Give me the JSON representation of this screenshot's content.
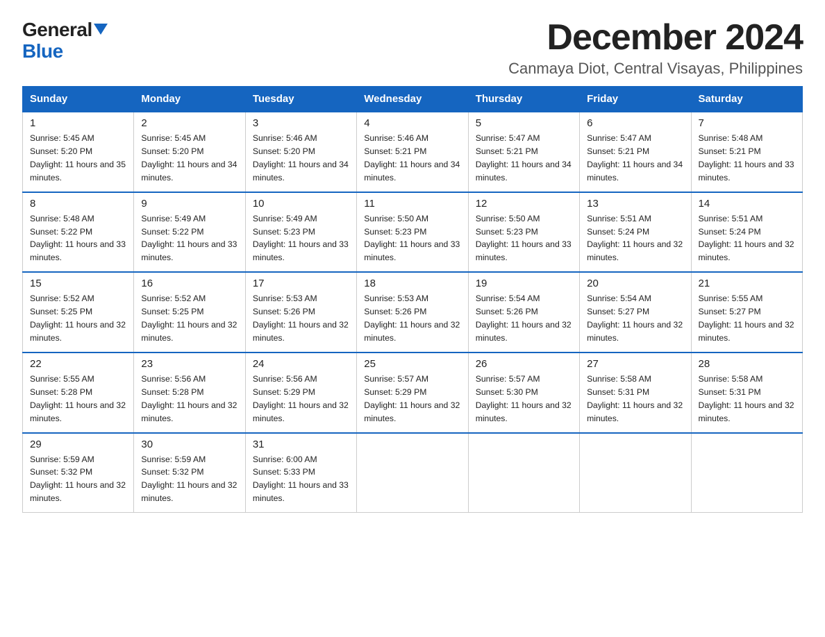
{
  "logo": {
    "general": "General",
    "blue": "Blue"
  },
  "title": "December 2024",
  "subtitle": "Canmaya Diot, Central Visayas, Philippines",
  "days_of_week": [
    "Sunday",
    "Monday",
    "Tuesday",
    "Wednesday",
    "Thursday",
    "Friday",
    "Saturday"
  ],
  "weeks": [
    [
      {
        "day": "1",
        "sunrise": "5:45 AM",
        "sunset": "5:20 PM",
        "daylight": "11 hours and 35 minutes."
      },
      {
        "day": "2",
        "sunrise": "5:45 AM",
        "sunset": "5:20 PM",
        "daylight": "11 hours and 34 minutes."
      },
      {
        "day": "3",
        "sunrise": "5:46 AM",
        "sunset": "5:20 PM",
        "daylight": "11 hours and 34 minutes."
      },
      {
        "day": "4",
        "sunrise": "5:46 AM",
        "sunset": "5:21 PM",
        "daylight": "11 hours and 34 minutes."
      },
      {
        "day": "5",
        "sunrise": "5:47 AM",
        "sunset": "5:21 PM",
        "daylight": "11 hours and 34 minutes."
      },
      {
        "day": "6",
        "sunrise": "5:47 AM",
        "sunset": "5:21 PM",
        "daylight": "11 hours and 34 minutes."
      },
      {
        "day": "7",
        "sunrise": "5:48 AM",
        "sunset": "5:21 PM",
        "daylight": "11 hours and 33 minutes."
      }
    ],
    [
      {
        "day": "8",
        "sunrise": "5:48 AM",
        "sunset": "5:22 PM",
        "daylight": "11 hours and 33 minutes."
      },
      {
        "day": "9",
        "sunrise": "5:49 AM",
        "sunset": "5:22 PM",
        "daylight": "11 hours and 33 minutes."
      },
      {
        "day": "10",
        "sunrise": "5:49 AM",
        "sunset": "5:23 PM",
        "daylight": "11 hours and 33 minutes."
      },
      {
        "day": "11",
        "sunrise": "5:50 AM",
        "sunset": "5:23 PM",
        "daylight": "11 hours and 33 minutes."
      },
      {
        "day": "12",
        "sunrise": "5:50 AM",
        "sunset": "5:23 PM",
        "daylight": "11 hours and 33 minutes."
      },
      {
        "day": "13",
        "sunrise": "5:51 AM",
        "sunset": "5:24 PM",
        "daylight": "11 hours and 32 minutes."
      },
      {
        "day": "14",
        "sunrise": "5:51 AM",
        "sunset": "5:24 PM",
        "daylight": "11 hours and 32 minutes."
      }
    ],
    [
      {
        "day": "15",
        "sunrise": "5:52 AM",
        "sunset": "5:25 PM",
        "daylight": "11 hours and 32 minutes."
      },
      {
        "day": "16",
        "sunrise": "5:52 AM",
        "sunset": "5:25 PM",
        "daylight": "11 hours and 32 minutes."
      },
      {
        "day": "17",
        "sunrise": "5:53 AM",
        "sunset": "5:26 PM",
        "daylight": "11 hours and 32 minutes."
      },
      {
        "day": "18",
        "sunrise": "5:53 AM",
        "sunset": "5:26 PM",
        "daylight": "11 hours and 32 minutes."
      },
      {
        "day": "19",
        "sunrise": "5:54 AM",
        "sunset": "5:26 PM",
        "daylight": "11 hours and 32 minutes."
      },
      {
        "day": "20",
        "sunrise": "5:54 AM",
        "sunset": "5:27 PM",
        "daylight": "11 hours and 32 minutes."
      },
      {
        "day": "21",
        "sunrise": "5:55 AM",
        "sunset": "5:27 PM",
        "daylight": "11 hours and 32 minutes."
      }
    ],
    [
      {
        "day": "22",
        "sunrise": "5:55 AM",
        "sunset": "5:28 PM",
        "daylight": "11 hours and 32 minutes."
      },
      {
        "day": "23",
        "sunrise": "5:56 AM",
        "sunset": "5:28 PM",
        "daylight": "11 hours and 32 minutes."
      },
      {
        "day": "24",
        "sunrise": "5:56 AM",
        "sunset": "5:29 PM",
        "daylight": "11 hours and 32 minutes."
      },
      {
        "day": "25",
        "sunrise": "5:57 AM",
        "sunset": "5:29 PM",
        "daylight": "11 hours and 32 minutes."
      },
      {
        "day": "26",
        "sunrise": "5:57 AM",
        "sunset": "5:30 PM",
        "daylight": "11 hours and 32 minutes."
      },
      {
        "day": "27",
        "sunrise": "5:58 AM",
        "sunset": "5:31 PM",
        "daylight": "11 hours and 32 minutes."
      },
      {
        "day": "28",
        "sunrise": "5:58 AM",
        "sunset": "5:31 PM",
        "daylight": "11 hours and 32 minutes."
      }
    ],
    [
      {
        "day": "29",
        "sunrise": "5:59 AM",
        "sunset": "5:32 PM",
        "daylight": "11 hours and 32 minutes."
      },
      {
        "day": "30",
        "sunrise": "5:59 AM",
        "sunset": "5:32 PM",
        "daylight": "11 hours and 32 minutes."
      },
      {
        "day": "31",
        "sunrise": "6:00 AM",
        "sunset": "5:33 PM",
        "daylight": "11 hours and 33 minutes."
      },
      null,
      null,
      null,
      null
    ]
  ]
}
